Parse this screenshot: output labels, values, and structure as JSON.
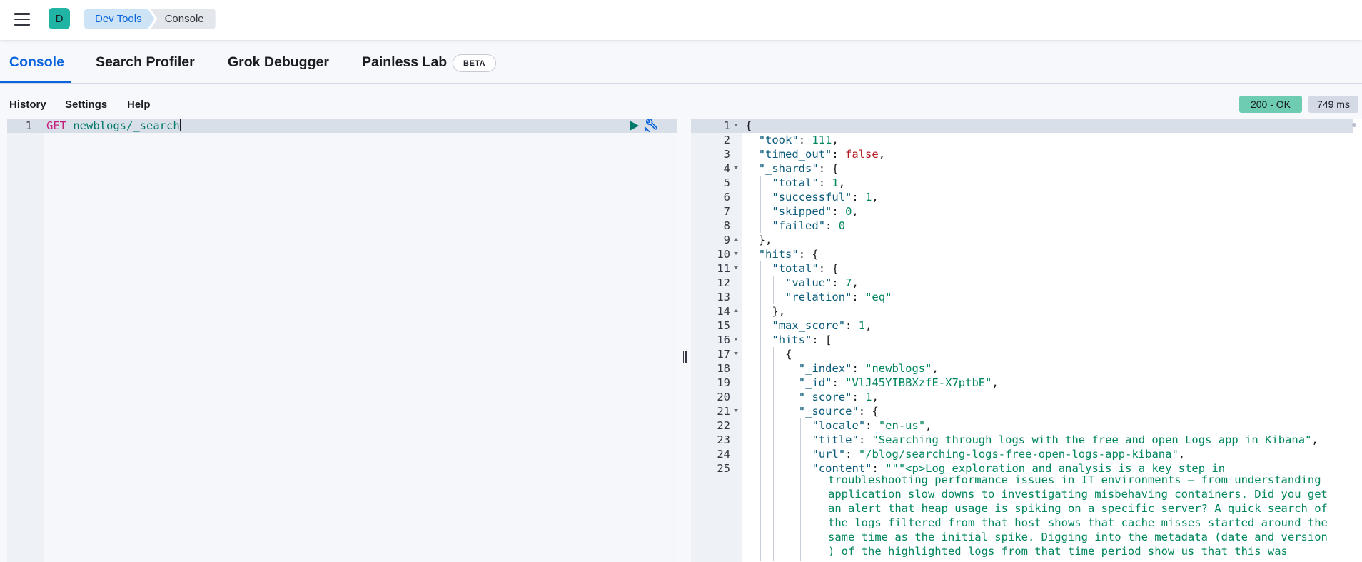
{
  "header": {
    "avatar_letter": "D",
    "breadcrumbs": [
      "Dev Tools",
      "Console"
    ]
  },
  "tabs": [
    {
      "label": "Console",
      "active": true
    },
    {
      "label": "Search Profiler",
      "active": false
    },
    {
      "label": "Grok Debugger",
      "active": false
    },
    {
      "label": "Painless Lab",
      "active": false
    }
  ],
  "beta_badge": "BETA",
  "toolbar": {
    "history": "History",
    "settings": "Settings",
    "help": "Help",
    "status": "200 - OK",
    "time": "749 ms"
  },
  "request": {
    "line_number": "1",
    "method": "GET",
    "path": "newblogs/_search"
  },
  "response": {
    "lines": [
      {
        "n": "1",
        "indent": 0,
        "fold": "down",
        "tokens": [
          [
            "p",
            "{"
          ]
        ]
      },
      {
        "n": "2",
        "indent": 1,
        "tokens": [
          [
            "k",
            "\"took\""
          ],
          [
            "p",
            ": "
          ],
          [
            "n",
            "111"
          ],
          [
            "p",
            ","
          ]
        ]
      },
      {
        "n": "3",
        "indent": 1,
        "tokens": [
          [
            "k",
            "\"timed_out\""
          ],
          [
            "p",
            ": "
          ],
          [
            "b",
            "false"
          ],
          [
            "p",
            ","
          ]
        ]
      },
      {
        "n": "4",
        "indent": 1,
        "fold": "down",
        "tokens": [
          [
            "k",
            "\"_shards\""
          ],
          [
            "p",
            ": {"
          ]
        ]
      },
      {
        "n": "5",
        "indent": 2,
        "tokens": [
          [
            "k",
            "\"total\""
          ],
          [
            "p",
            ": "
          ],
          [
            "n",
            "1"
          ],
          [
            "p",
            ","
          ]
        ]
      },
      {
        "n": "6",
        "indent": 2,
        "tokens": [
          [
            "k",
            "\"successful\""
          ],
          [
            "p",
            ": "
          ],
          [
            "n",
            "1"
          ],
          [
            "p",
            ","
          ]
        ]
      },
      {
        "n": "7",
        "indent": 2,
        "tokens": [
          [
            "k",
            "\"skipped\""
          ],
          [
            "p",
            ": "
          ],
          [
            "n",
            "0"
          ],
          [
            "p",
            ","
          ]
        ]
      },
      {
        "n": "8",
        "indent": 2,
        "tokens": [
          [
            "k",
            "\"failed\""
          ],
          [
            "p",
            ": "
          ],
          [
            "n",
            "0"
          ]
        ]
      },
      {
        "n": "9",
        "indent": 1,
        "fold": "up",
        "tokens": [
          [
            "p",
            "},"
          ]
        ]
      },
      {
        "n": "10",
        "indent": 1,
        "fold": "down",
        "tokens": [
          [
            "k",
            "\"hits\""
          ],
          [
            "p",
            ": {"
          ]
        ]
      },
      {
        "n": "11",
        "indent": 2,
        "fold": "down",
        "tokens": [
          [
            "k",
            "\"total\""
          ],
          [
            "p",
            ": {"
          ]
        ]
      },
      {
        "n": "12",
        "indent": 3,
        "tokens": [
          [
            "k",
            "\"value\""
          ],
          [
            "p",
            ": "
          ],
          [
            "n",
            "7"
          ],
          [
            "p",
            ","
          ]
        ]
      },
      {
        "n": "13",
        "indent": 3,
        "tokens": [
          [
            "k",
            "\"relation\""
          ],
          [
            "p",
            ": "
          ],
          [
            "s",
            "\"eq\""
          ]
        ]
      },
      {
        "n": "14",
        "indent": 2,
        "fold": "up",
        "tokens": [
          [
            "p",
            "},"
          ]
        ]
      },
      {
        "n": "15",
        "indent": 2,
        "tokens": [
          [
            "k",
            "\"max_score\""
          ],
          [
            "p",
            ": "
          ],
          [
            "n",
            "1"
          ],
          [
            "p",
            ","
          ]
        ]
      },
      {
        "n": "16",
        "indent": 2,
        "fold": "down",
        "tokens": [
          [
            "k",
            "\"hits\""
          ],
          [
            "p",
            ": ["
          ]
        ]
      },
      {
        "n": "17",
        "indent": 3,
        "fold": "down",
        "tokens": [
          [
            "p",
            "{"
          ]
        ]
      },
      {
        "n": "18",
        "indent": 4,
        "tokens": [
          [
            "k",
            "\"_index\""
          ],
          [
            "p",
            ": "
          ],
          [
            "s",
            "\"newblogs\""
          ],
          [
            "p",
            ","
          ]
        ]
      },
      {
        "n": "19",
        "indent": 4,
        "tokens": [
          [
            "k",
            "\"_id\""
          ],
          [
            "p",
            ": "
          ],
          [
            "s",
            "\"VlJ45YIBBXzfE-X7ptbE\""
          ],
          [
            "p",
            ","
          ]
        ]
      },
      {
        "n": "20",
        "indent": 4,
        "tokens": [
          [
            "k",
            "\"_score\""
          ],
          [
            "p",
            ": "
          ],
          [
            "n",
            "1"
          ],
          [
            "p",
            ","
          ]
        ]
      },
      {
        "n": "21",
        "indent": 4,
        "fold": "down",
        "tokens": [
          [
            "k",
            "\"_source\""
          ],
          [
            "p",
            ": {"
          ]
        ]
      },
      {
        "n": "22",
        "indent": 5,
        "tokens": [
          [
            "k",
            "\"locale\""
          ],
          [
            "p",
            ": "
          ],
          [
            "s",
            "\"en-us\""
          ],
          [
            "p",
            ","
          ]
        ]
      },
      {
        "n": "23",
        "indent": 5,
        "tokens": [
          [
            "k",
            "\"title\""
          ],
          [
            "p",
            ": "
          ],
          [
            "s",
            "\"Searching through logs with the free and open Logs app in Kibana\""
          ],
          [
            "p",
            ","
          ]
        ]
      },
      {
        "n": "24",
        "indent": 5,
        "tokens": [
          [
            "k",
            "\"url\""
          ],
          [
            "p",
            ": "
          ],
          [
            "s",
            "\"/blog/searching-logs-free-open-logs-app-kibana\""
          ],
          [
            "p",
            ","
          ]
        ]
      },
      {
        "n": "25",
        "indent": 5,
        "tokens": [
          [
            "k",
            "\"content\""
          ],
          [
            "p",
            ": "
          ],
          [
            "s",
            "\"\"\"<p>Log exploration and analysis is a key step in"
          ]
        ]
      }
    ],
    "content_wrapped": [
      "troubleshooting performance issues in IT environments — from understanding",
      "application slow downs to investigating misbehaving containers. Did you get",
      "an alert that heap usage is spiking on a specific server? A quick search of",
      "the logs filtered from that host shows that cache misses started around the",
      "same time as the initial spike. Digging into the metadata (date and version",
      ") of the highlighted logs from that time period show us that this was"
    ]
  }
}
